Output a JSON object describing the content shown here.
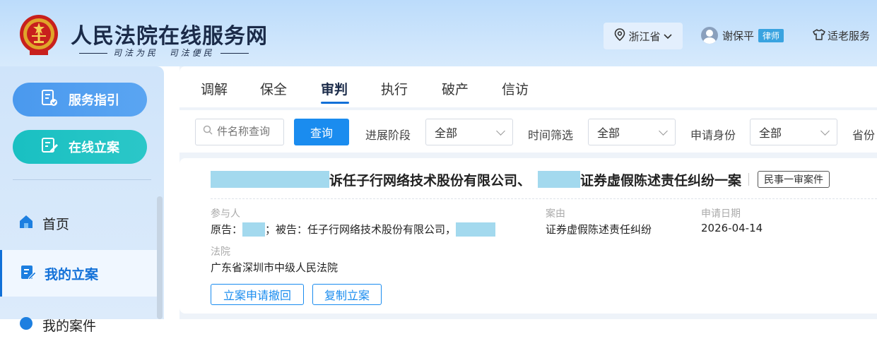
{
  "header": {
    "site_title": "人民法院在线服务网",
    "slogan_left": "司法为民",
    "slogan_right": "司法便民",
    "region": "浙江省",
    "user_name": "谢保平",
    "user_role": "律师",
    "elder_service": "适老服务"
  },
  "sidebar": {
    "service_guide": "服务指引",
    "online_filing": "在线立案",
    "nav": [
      {
        "label": "首页"
      },
      {
        "label": "我的立案"
      },
      {
        "label": "我的案件"
      }
    ]
  },
  "tabs": [
    {
      "label": "调解"
    },
    {
      "label": "保全"
    },
    {
      "label": "审判"
    },
    {
      "label": "执行"
    },
    {
      "label": "破产"
    },
    {
      "label": "信访"
    }
  ],
  "active_tab": "审判",
  "filters": {
    "search_placeholder": "件名称查询",
    "query_label": "查询",
    "stage_label": "进展阶段",
    "stage_value": "全部",
    "time_label": "时间筛选",
    "time_value": "全部",
    "identity_label": "申请身份",
    "identity_value": "全部",
    "province_label": "省份"
  },
  "case": {
    "title_text": "诉任子行网络技术股份有限公司、",
    "title_suffix": "证券虚假陈述责任纠纷一案",
    "tag": "民事一审案件",
    "participants_label": "参与人",
    "plaintiff_prefix": "原告：",
    "defendant_text": "；被告：任子行网络技术股份有限公司，",
    "cause_label": "案由",
    "cause_value": "证券虚假陈述责任纠纷",
    "date_label": "申请日期",
    "date_value": "2026-04-14",
    "court_label": "法院",
    "court_value": "广东省深圳市中级人民法院",
    "withdraw_button": "立案申请撤回",
    "copy_button": "复制立案"
  },
  "colors": {
    "primary": "#1a8cef",
    "redaction": "#a3d9ee",
    "pill_blue": "#4a99ee",
    "pill_teal": "#19c0c2"
  },
  "icons": [
    "court-emblem-icon",
    "location-pin-icon",
    "chevron-down-icon",
    "user-avatar-icon",
    "shirt-icon",
    "service-guide-icon",
    "online-filing-icon",
    "home-icon",
    "filing-doc-icon",
    "case-icon",
    "search-icon"
  ]
}
